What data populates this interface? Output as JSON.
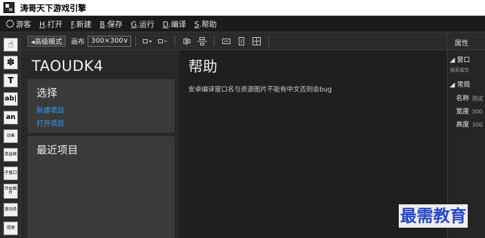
{
  "window": {
    "title": "涛哥天下游戏引擎"
  },
  "menu": {
    "items": [
      {
        "label": "游客"
      },
      {
        "key": "H",
        "label": ".打开"
      },
      {
        "key": "F",
        "label": ".新建"
      },
      {
        "key": "B",
        "label": ".保存"
      },
      {
        "key": "G",
        "label": ".运行"
      },
      {
        "key": "D",
        "label": ".编译"
      },
      {
        "key": "S",
        "label": ".帮助"
      }
    ]
  },
  "tools": [
    {
      "icon": "hand-icon",
      "glyph": "☝"
    },
    {
      "icon": "puzzle-icon",
      "glyph": "✽"
    },
    {
      "label": "T"
    },
    {
      "label": "ab|"
    },
    {
      "label": "an"
    },
    {
      "label": "动画"
    },
    {
      "label": "单选框"
    },
    {
      "label": "子窗口"
    },
    {
      "label": "开始图片"
    },
    {
      "label": "滚动条"
    },
    {
      "label": "视频"
    }
  ],
  "toolbar": {
    "mode": "◂高级模式",
    "canvas_label": "画布",
    "canvas_size": "300×300"
  },
  "left": {
    "app_title": "TAOUDK4",
    "choose_title": "选择",
    "new_project": "新建项目",
    "open_project": "打开项目",
    "recent_title": "最近项目"
  },
  "help": {
    "title": "帮助",
    "text": "安卓编译窗口名与资源图片不能有中文否则会bug"
  },
  "props": {
    "title": "属性",
    "window_section": "◢ 窗口",
    "search": "搜索属性",
    "general_section": "◢ 常规",
    "rows": [
      {
        "label": "名称",
        "value": "测试"
      },
      {
        "label": "宽度",
        "value": "300"
      },
      {
        "label": "高度",
        "value": "300"
      }
    ]
  },
  "watermark": "最需教育"
}
